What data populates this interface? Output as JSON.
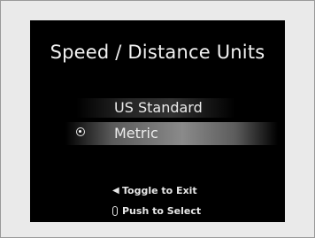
{
  "screen": {
    "title": "Speed / Distance Units",
    "options": [
      {
        "label": "US Standard",
        "selected": false
      },
      {
        "label": "Metric",
        "selected": true
      }
    ],
    "hints": {
      "exit": {
        "icon": "left-triangle-icon",
        "label": "Toggle to Exit"
      },
      "select": {
        "icon": "push-knob-icon",
        "label": "Push to Select"
      }
    }
  },
  "colors": {
    "screen_background": "#000000",
    "frame_background": "#eaeaea",
    "text": "#f2f2f2",
    "highlight": "#8a8a8a"
  }
}
